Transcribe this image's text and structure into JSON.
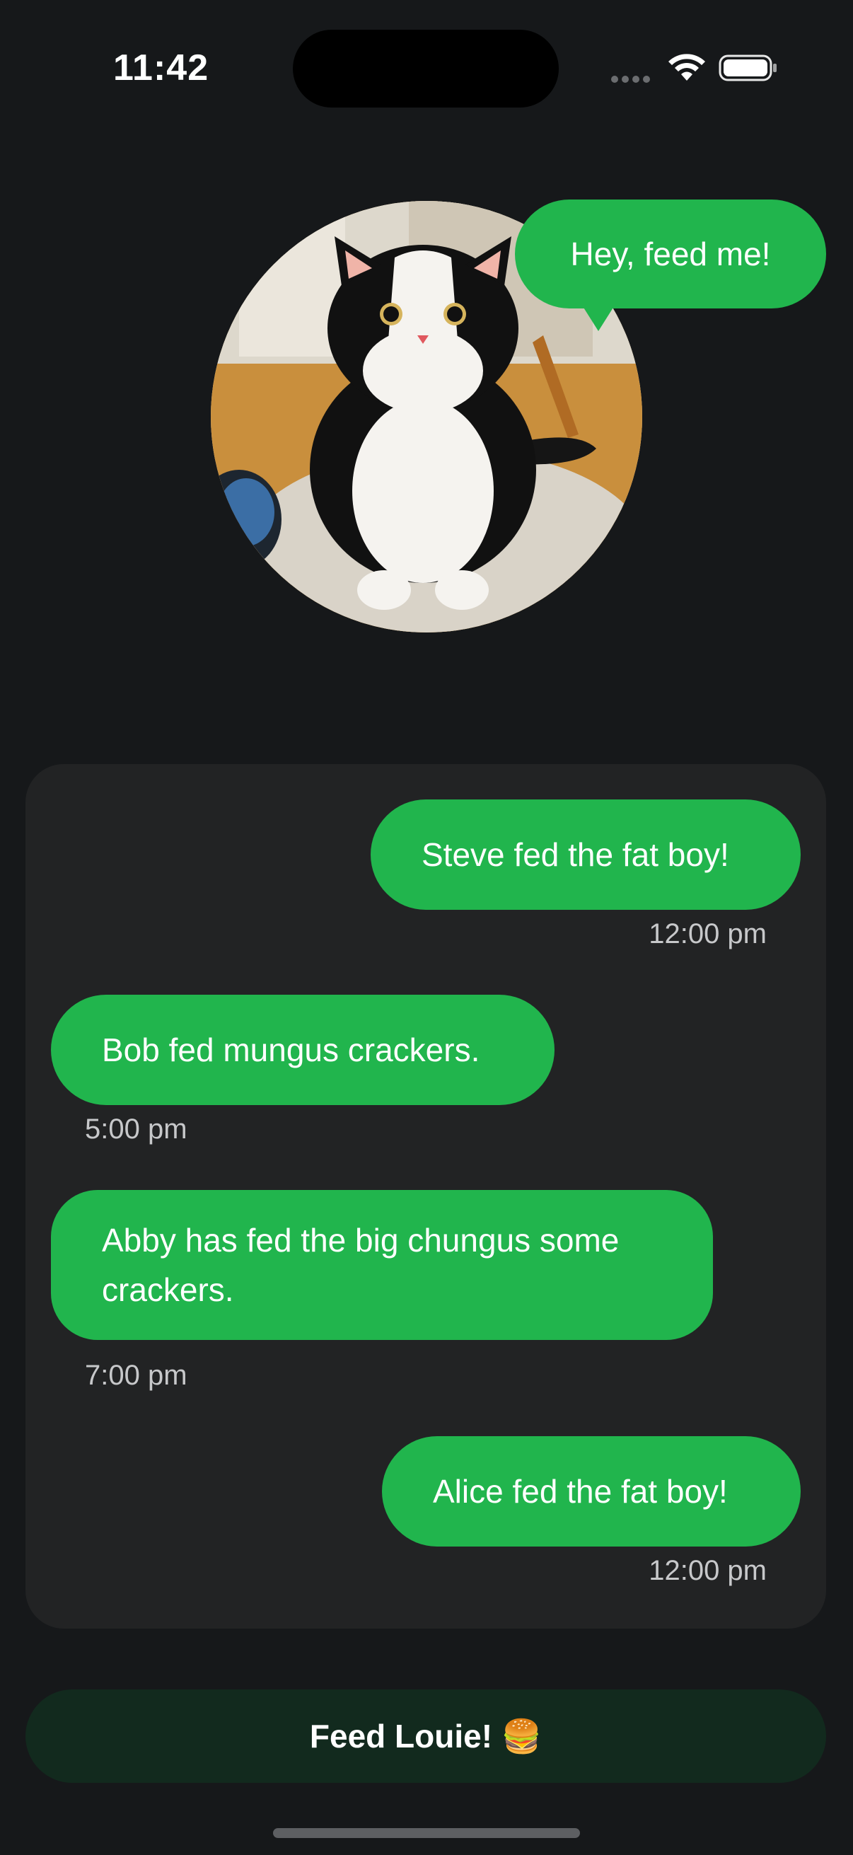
{
  "status_bar": {
    "time": "11:42",
    "icons": [
      "cellular-signal-icon",
      "wifi-icon",
      "battery-icon"
    ]
  },
  "hero": {
    "avatar": "cat-photo",
    "speech": "Hey, feed me!"
  },
  "feed_log": {
    "entries": [
      {
        "text": "Steve fed the fat boy!",
        "time": "12:00 pm",
        "side": "right"
      },
      {
        "text": "Bob fed mungus crackers.",
        "time": "5:00 pm",
        "side": "left"
      },
      {
        "text": "Abby has fed the big chungus some crackers.",
        "time": "7:00 pm",
        "side": "left"
      },
      {
        "text": "Alice fed the fat boy!",
        "time": "12:00 pm",
        "side": "right"
      }
    ]
  },
  "action": {
    "label": "Feed Louie! 🍔"
  },
  "colors": {
    "background": "#16181a",
    "panel": "#222324",
    "bubble": "#21b54d",
    "button": "#122a1e"
  }
}
